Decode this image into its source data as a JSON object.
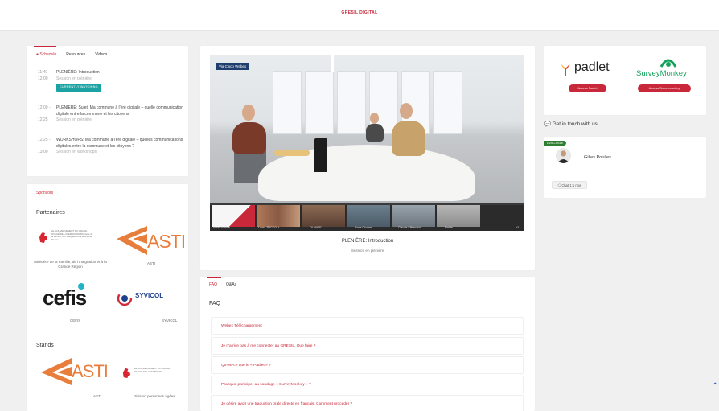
{
  "header": {
    "brand": "GRESIL DIGITAL"
  },
  "schedule": {
    "tabs": [
      "Schedule",
      "Resources",
      "Videos"
    ],
    "items": [
      {
        "time_start": "11:40 -",
        "time_end": "12:00",
        "title": "PLENIÈRE: Introduction",
        "subtitle": "Session en plénière",
        "badge": "CURRENTLY WATCHING"
      },
      {
        "time_start": "12:00 -",
        "time_end": "12:25",
        "title": "PLENIÈRE: Sujet: Ma commune à l'ère digitale – quelle communication digitale entre la commune et les citoyens",
        "subtitle": "Session en plénière"
      },
      {
        "time_start": "12:25 -",
        "time_end": "13:00",
        "title": "WORKSHOPS: Ma commune à l'ère digitale – quelles communications digitales entre la commune et les citoyens ?",
        "subtitle": "Session en workshops"
      }
    ]
  },
  "sponsors": {
    "title": "Sponsors",
    "partners_title": "Partenaires",
    "partners": [
      {
        "caption": "Ministère de la Famille, de l'Intégration et à la Grande Région",
        "logo_text": "LE GOUVERNEMENT DU GRAND-DUCHÉ DE LUXEMBOURG Ministère de la Famille, de l'Intégration et à la Grande Région"
      },
      {
        "caption": "ASTI",
        "logo_text": "ASTI"
      },
      {
        "caption": "CEFIS",
        "logo_text": "cefis"
      },
      {
        "caption": "SYVICOL",
        "logo_text": "SYVICOL"
      }
    ],
    "stands_title": "Stands",
    "stands": [
      {
        "caption": "ASTI",
        "logo_text": "ASTI"
      },
      {
        "caption": "Division personnes âgées",
        "logo_text": "LE GOUVERNEMENT DU GRAND-DUCHÉ DE LUXEMBOURG"
      }
    ]
  },
  "video": {
    "via_badge": "Via Cisco Webex",
    "participants": [
      "Peter Poehle",
      "Laura ZUCCOLI",
      "OLIVATE",
      "Anne Osorne",
      "Claude Silbenator",
      "Emilie"
    ],
    "overflow_count": "+2",
    "title": "PLENIÈRE: Introduction",
    "subtitle": "Session en plénière"
  },
  "faq": {
    "tabs": [
      "FAQ",
      "Q&As"
    ],
    "heading": "FAQ",
    "questions": [
      "Webex Téléchargement",
      "Je n'arrive pas à me connecter au GRESIL. Que faire ?",
      "Qu'est-ce que le « Padlet » ?",
      "Pourquoi participer au sondage « SurveyMonkey » ?",
      "Je désire avoir une traduction orale directe en français. Comment procéder ?"
    ]
  },
  "tools": {
    "padlet": {
      "name": "padlet",
      "button": "Access Padlet"
    },
    "survey": {
      "name": "SurveyMonkey",
      "button": "Access Surveymonkey"
    }
  },
  "contact": {
    "heading": "Get in touch with us",
    "status": "AVAILABLE",
    "name": "Gilles Poulies",
    "chat_button": "Chat 1:1 now"
  },
  "colors": {
    "accent": "#c8283a",
    "teal": "#1ba3a3",
    "available": "#2e7d32",
    "webex": "#1f3d6d"
  }
}
